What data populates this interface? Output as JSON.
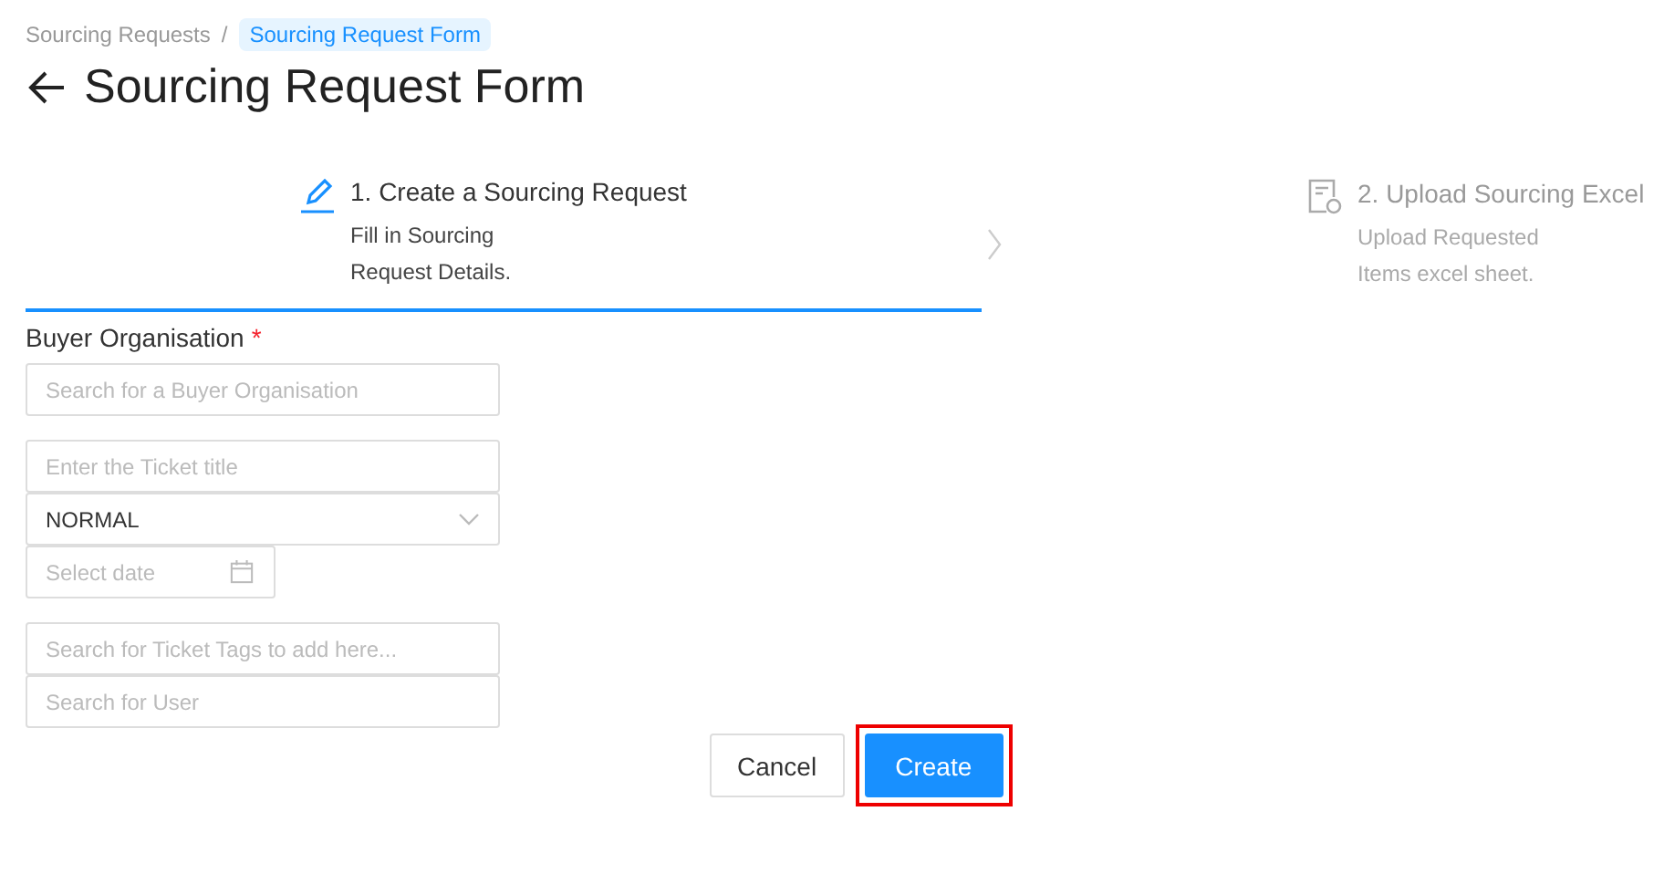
{
  "breadcrumb": [
    {
      "label": "Sourcing Requests",
      "selected": false
    },
    {
      "label": "Sourcing Request Form",
      "selected": true
    }
  ],
  "breadcrumb_separator": "/",
  "title": "Sourcing Request Form",
  "steps": [
    {
      "kind": "edit",
      "title": "1. Create a Sourcing Request",
      "description": [
        "Fill in Sourcing",
        "Request Details."
      ],
      "selected": true
    },
    {
      "kind": "upload",
      "title": "2. Upload Sourcing Excel",
      "description": [
        "Upload Requested",
        "Items excel sheet."
      ],
      "selected": false
    }
  ],
  "form": {
    "label": "Buyer Organisation",
    "required_mark": "*",
    "field_groups": [
      [
        {
          "kind": "input",
          "placeholder": "Search for a Buyer Organisation"
        }
      ],
      [
        {
          "kind": "input",
          "placeholder": "Enter the Ticket title"
        },
        {
          "kind": "select",
          "value": "NORMAL"
        },
        {
          "kind": "date",
          "placeholder": "Select date"
        }
      ],
      [
        {
          "kind": "input",
          "placeholder": "Search for Ticket Tags to add here..."
        },
        {
          "kind": "input",
          "placeholder": "Search for User"
        }
      ]
    ]
  },
  "buttons": [
    {
      "label": "Cancel",
      "kind": "default",
      "highlighted": false
    },
    {
      "label": "Create",
      "kind": "primary",
      "highlighted": true
    }
  ]
}
